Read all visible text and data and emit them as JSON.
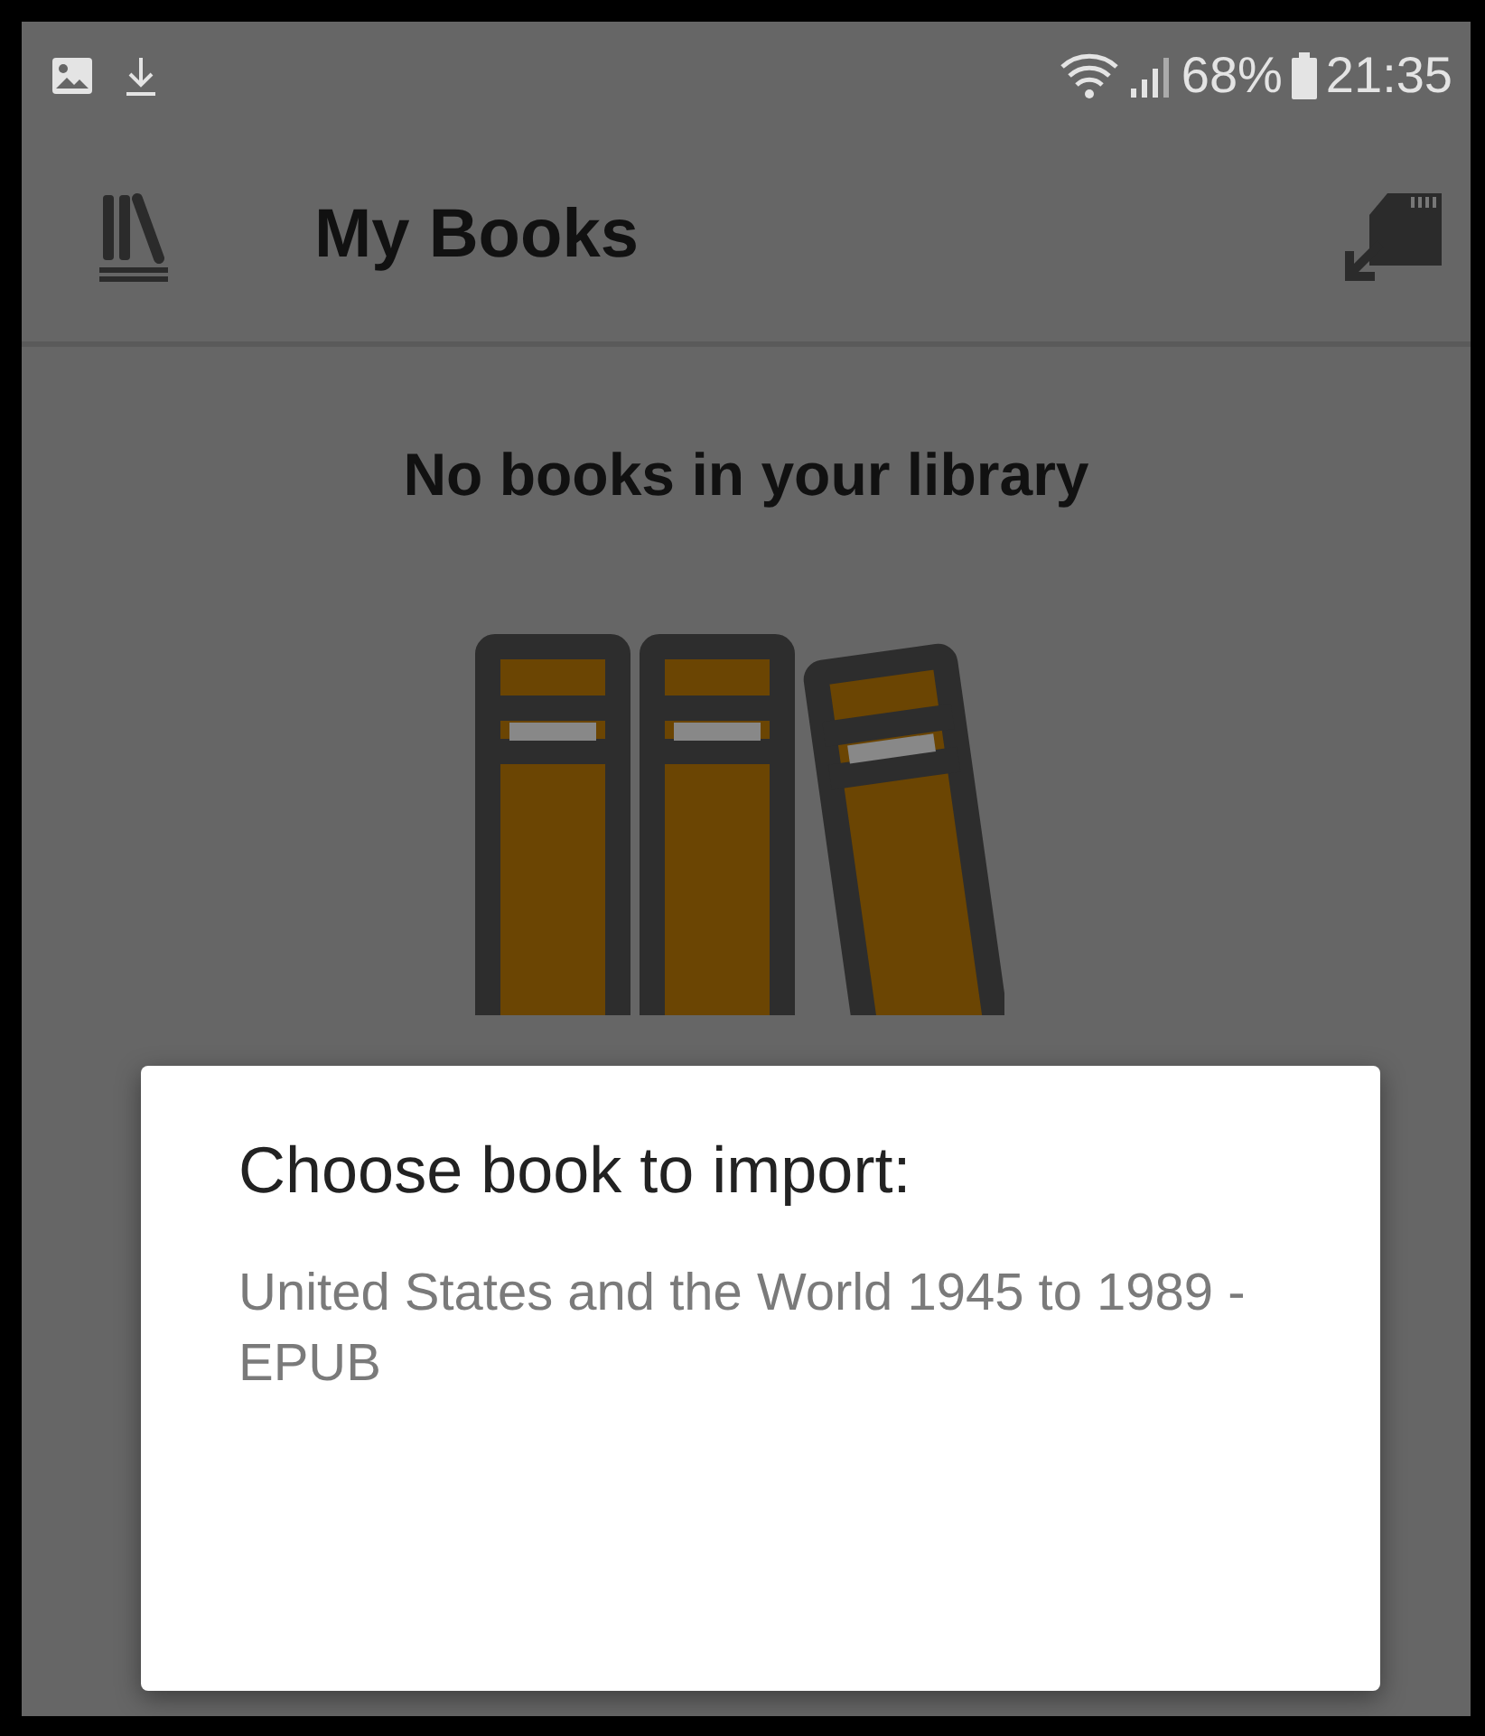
{
  "status_bar": {
    "battery": "68%",
    "time": "21:35"
  },
  "app_bar": {
    "title": "My Books"
  },
  "empty_message": "No books in your library",
  "dialog": {
    "title": "Choose book to import:",
    "items": [
      "United States and the World 1945 to 1989 - EPUB"
    ]
  }
}
